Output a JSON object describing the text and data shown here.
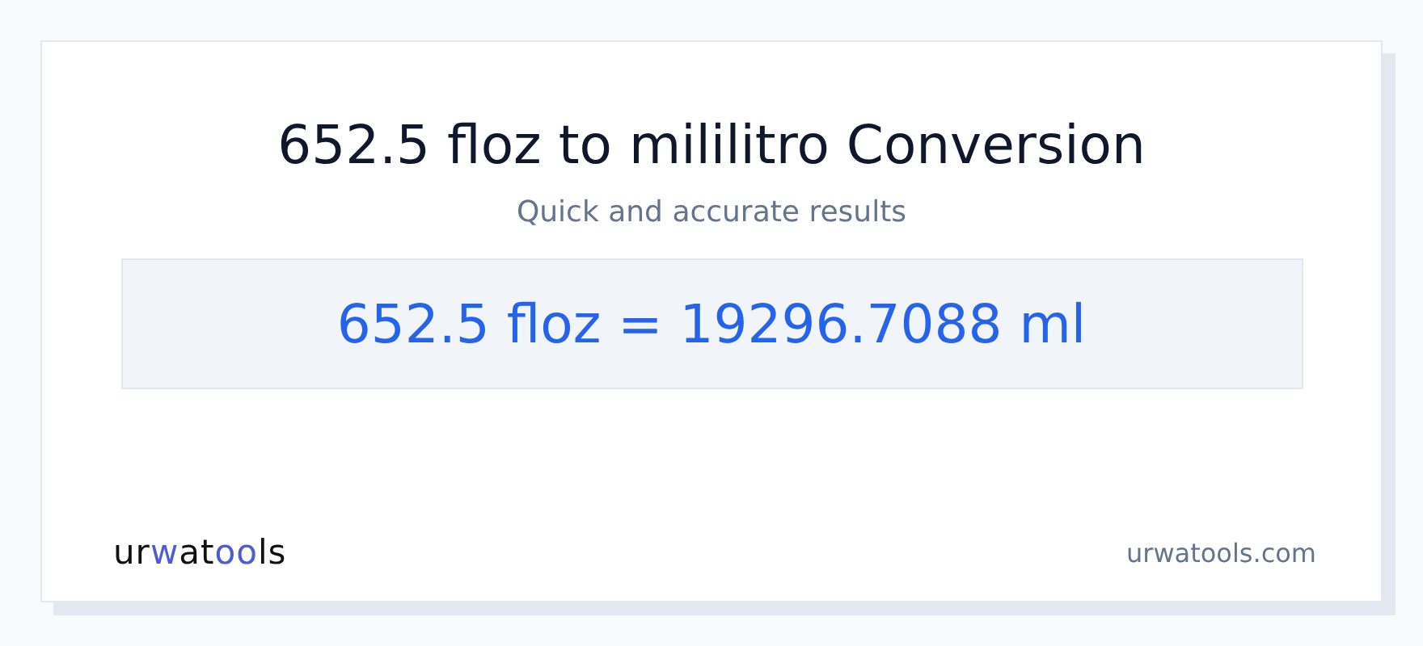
{
  "title": "652.5 floz to mililitro Conversion",
  "subtitle": "Quick and accurate results",
  "result": "652.5 floz = 19296.7088 ml",
  "logo": {
    "parts": [
      {
        "text": "ur",
        "accent": false
      },
      {
        "text": "w",
        "accent": true
      },
      {
        "text": "at",
        "accent": false
      },
      {
        "text": "oo",
        "accent": true
      },
      {
        "text": "ls",
        "accent": false
      }
    ]
  },
  "site": "urwatools.com"
}
